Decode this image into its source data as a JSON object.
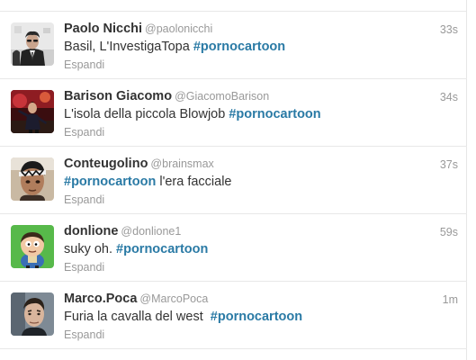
{
  "tweets": [
    {
      "fullname": "Paolo Nicchi",
      "username": "@paolonicchi",
      "time": "33s",
      "text_before": "Basil, L'InvestigaTopa ",
      "hashtag": "#pornocartoon",
      "text_after": "",
      "expand": "Espandi",
      "avatar": "avatar-photo-man-suit"
    },
    {
      "fullname": "Barison Giacomo",
      "username": "@GiacomoBarison",
      "time": "34s",
      "text_before": "L'isola della piccola Blowjob ",
      "hashtag": "#pornocartoon",
      "text_after": "",
      "expand": "Espandi",
      "avatar": "avatar-photo-red-scene"
    },
    {
      "fullname": "Conteugolino",
      "username": "@brainsmax",
      "time": "37s",
      "text_before": "",
      "hashtag": "#pornocartoon",
      "text_after": " l'era facciale",
      "expand": "Espandi",
      "avatar": "avatar-photo-man-headband"
    },
    {
      "fullname": "donlione",
      "username": "@donlione1",
      "time": "59s",
      "text_before": "suky oh. ",
      "hashtag": "#pornocartoon",
      "text_after": "",
      "expand": "Espandi",
      "avatar": "avatar-cartoon-character"
    },
    {
      "fullname": "Marco.Poca",
      "username": "@MarcoPoca",
      "time": "1m",
      "text_before": "Furia la cavalla del west  ",
      "hashtag": "#pornocartoon",
      "text_after": "",
      "expand": "Espandi",
      "avatar": "avatar-photo-man-portrait"
    }
  ],
  "colors": {
    "hashtag": "#2a7aa5",
    "meta": "#999999",
    "text": "#333333",
    "divider": "#e8e8e8"
  }
}
